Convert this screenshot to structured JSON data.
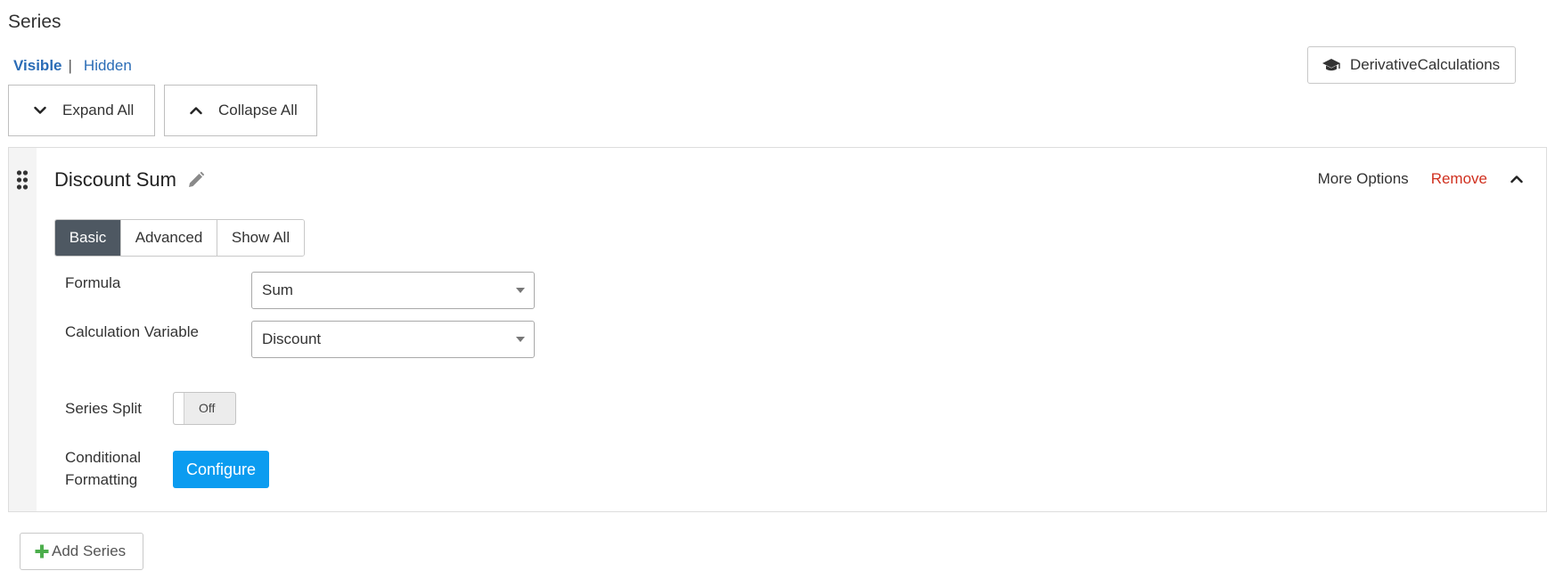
{
  "page": {
    "title": "Series"
  },
  "visibility": {
    "visible_label": "Visible",
    "separator": "|",
    "hidden_label": "Hidden",
    "active": "Visible"
  },
  "toolbar": {
    "expand_all_label": "Expand All",
    "collapse_all_label": "Collapse All",
    "derivative_label": "DerivativeCalculations",
    "derivative_icon": "graduation-cap-icon"
  },
  "series_card": {
    "name": "Discount Sum",
    "more_options_label": "More Options",
    "remove_label": "Remove",
    "tabs": [
      {
        "label": "Basic",
        "active": true
      },
      {
        "label": "Advanced",
        "active": false
      },
      {
        "label": "Show All",
        "active": false
      }
    ],
    "fields": {
      "formula": {
        "label": "Formula",
        "value": "Sum"
      },
      "calculation_variable": {
        "label": "Calculation Variable",
        "value": "Discount"
      },
      "series_split": {
        "label": "Series Split",
        "state": "Off"
      },
      "conditional_formatting": {
        "label_line1": "Conditional",
        "label_line2": "Formatting",
        "button_label": "Configure"
      }
    }
  },
  "footer": {
    "add_series_label": "Add Series"
  },
  "colors": {
    "link": "#2a6cb6",
    "remove": "#d0301f",
    "active_tab": "#4e5862",
    "primary_button": "#0b9cf0",
    "add_icon": "#4cae4c"
  }
}
